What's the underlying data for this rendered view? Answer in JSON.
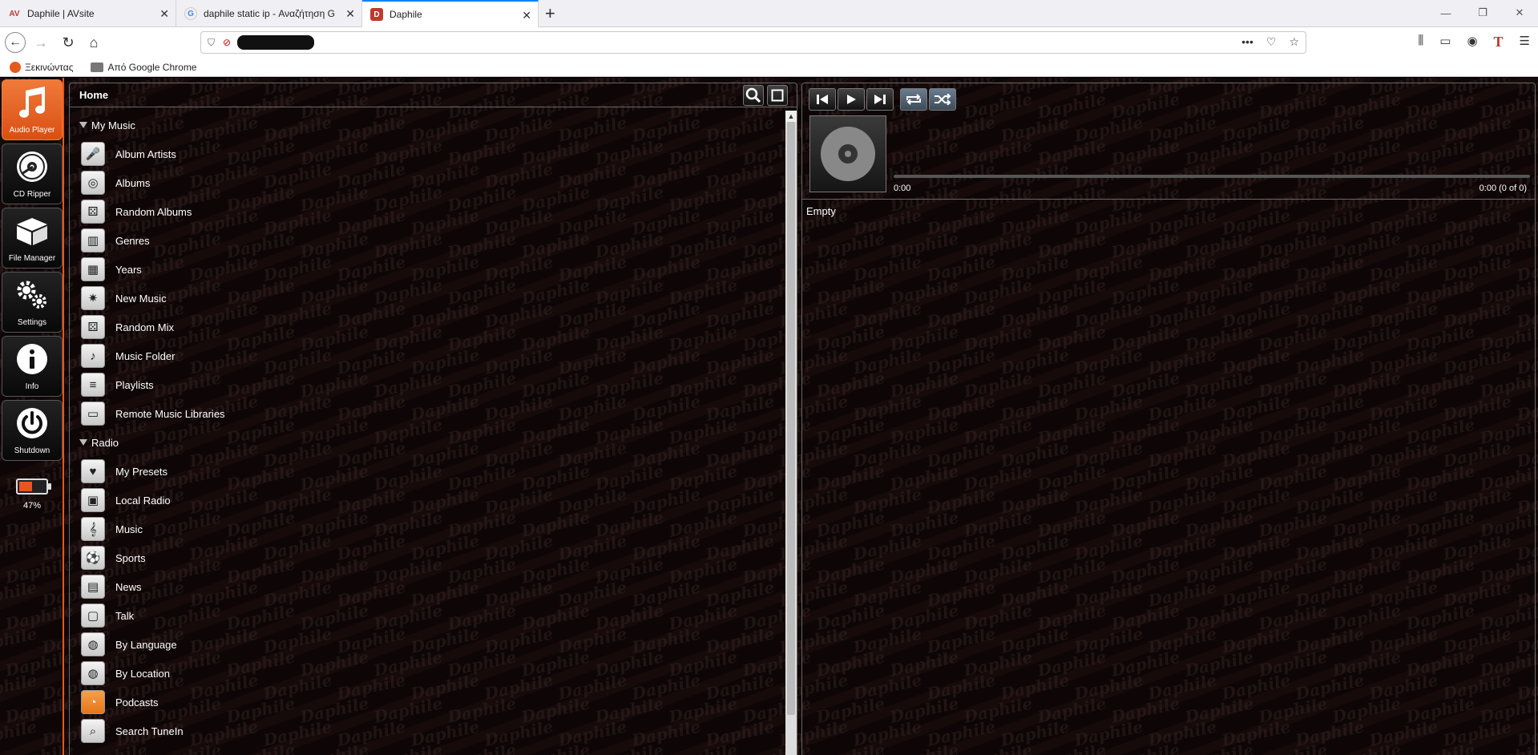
{
  "browser": {
    "tabs": [
      {
        "label": "Daphile | AVsite",
        "favicon": "AV"
      },
      {
        "label": "daphile static ip - Αναζήτηση G",
        "favicon": "G"
      },
      {
        "label": "Daphile",
        "favicon": "D"
      }
    ],
    "bookmarks": [
      {
        "label": "Ξεκινώντας"
      },
      {
        "label": "Από Google Chrome"
      }
    ]
  },
  "sidebar": {
    "items": [
      {
        "label": "Audio Player",
        "icon": "music-note-icon"
      },
      {
        "label": "CD Ripper",
        "icon": "cd-icon"
      },
      {
        "label": "File Manager",
        "icon": "box-icon"
      },
      {
        "label": "Settings",
        "icon": "gears-icon"
      },
      {
        "label": "Info",
        "icon": "info-icon"
      },
      {
        "label": "Shutdown",
        "icon": "power-icon"
      }
    ],
    "battery": "47%"
  },
  "browser_panel": {
    "title": "Home",
    "sections": [
      {
        "label": "My Music",
        "items": [
          {
            "label": "Album Artists",
            "icon": "artist-icon"
          },
          {
            "label": "Albums",
            "icon": "albums-icon"
          },
          {
            "label": "Random Albums",
            "icon": "dice-icon"
          },
          {
            "label": "Genres",
            "icon": "piano-icon"
          },
          {
            "label": "Years",
            "icon": "calendar-icon"
          },
          {
            "label": "New Music",
            "icon": "new-badge-icon"
          },
          {
            "label": "Random Mix",
            "icon": "dice-icon"
          },
          {
            "label": "Music Folder",
            "icon": "folder-icon"
          },
          {
            "label": "Playlists",
            "icon": "playlist-icon"
          },
          {
            "label": "Remote Music Libraries",
            "icon": "laptop-icon"
          }
        ]
      },
      {
        "label": "Radio",
        "items": [
          {
            "label": "My Presets",
            "icon": "heart-icon"
          },
          {
            "label": "Local Radio",
            "icon": "radio-icon"
          },
          {
            "label": "Music",
            "icon": "clef-icon"
          },
          {
            "label": "Sports",
            "icon": "ball-icon"
          },
          {
            "label": "News",
            "icon": "news-icon"
          },
          {
            "label": "Talk",
            "icon": "speech-icon"
          },
          {
            "label": "By Language",
            "icon": "globe-icon"
          },
          {
            "label": "By Location",
            "icon": "globe-icon"
          },
          {
            "label": "Podcasts",
            "icon": "rss-icon"
          },
          {
            "label": "Search TuneIn",
            "icon": "search-icon"
          }
        ]
      }
    ]
  },
  "player": {
    "time_current": "0:00",
    "time_total": "0:00  (0 of 0)",
    "playlist_status": "Empty",
    "progress": 0
  }
}
